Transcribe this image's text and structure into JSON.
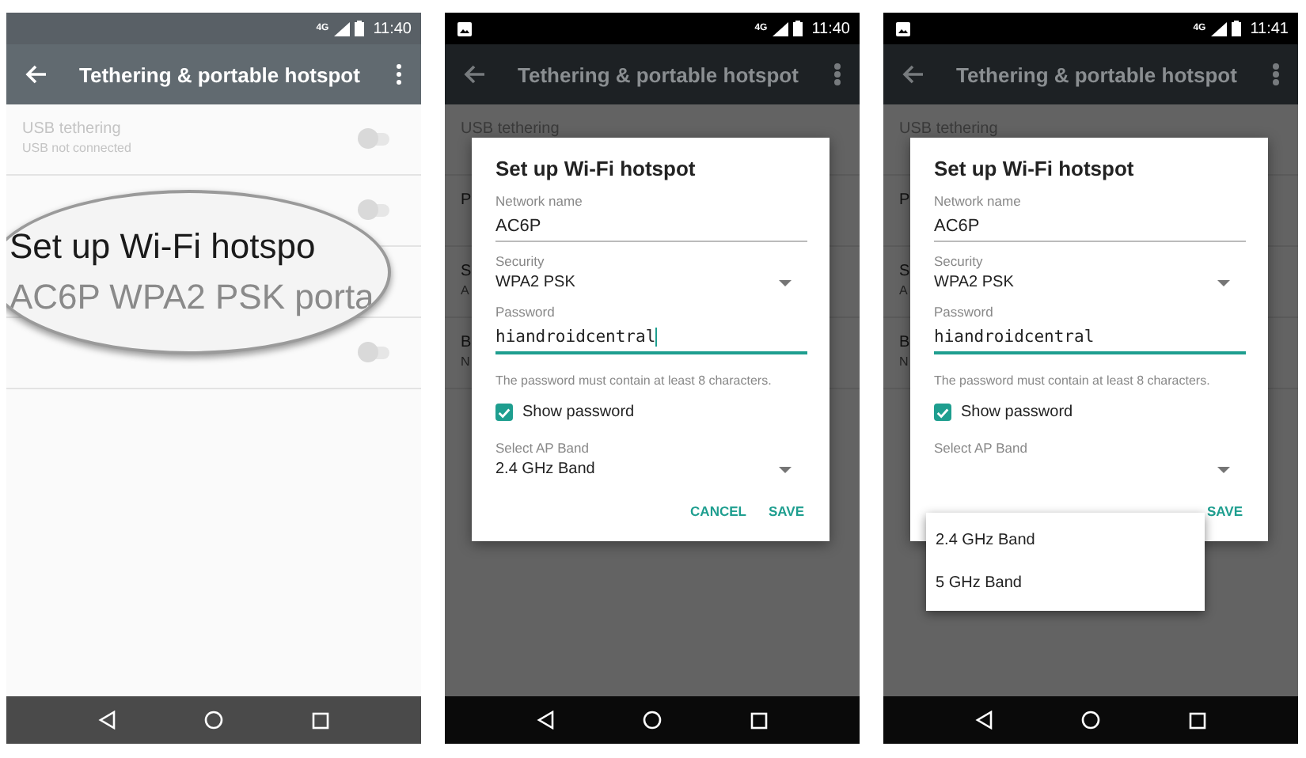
{
  "screens": [
    {
      "status": {
        "time": "11:40",
        "network": "4G",
        "notification_icon": false
      },
      "toolbar": {
        "title": "Tethering & portable hotspot"
      },
      "dimmed": false,
      "rows": [
        {
          "title": "USB tethering",
          "subtitle": "USB not connected",
          "disabled": true,
          "toggle": {
            "on": false
          }
        },
        {
          "toggle": {
            "on": false
          }
        },
        {},
        {
          "toggle": {
            "on": false
          }
        }
      ],
      "magnifier": {
        "lines": [
          "Set up Wi-Fi hotspo",
          "AC6P WPA2 PSK porta"
        ]
      }
    },
    {
      "status": {
        "time": "11:40",
        "network": "4G",
        "notification_icon": true
      },
      "toolbar": {
        "title": "Tethering & portable hotspot"
      },
      "dimmed": true,
      "rows": [
        {
          "title": "USB tethering",
          "disabled": true
        },
        {
          "title": "P"
        },
        {
          "title": "S",
          "subtitle": "A"
        },
        {
          "title": "B",
          "subtitle": "N"
        }
      ],
      "dialog": {
        "title": "Set up Wi-Fi hotspot",
        "fields": [
          {
            "kind": "text",
            "label": "Network name",
            "value": "AC6P",
            "focused": false,
            "cursor": false,
            "mono": false
          },
          {
            "kind": "select",
            "label": "Security",
            "value": "WPA2 PSK"
          },
          {
            "kind": "text",
            "label": "Password",
            "value": "hiandroidcentral",
            "focused": true,
            "cursor": true,
            "mono": true
          },
          {
            "kind": "hint",
            "text": "The password must contain at least 8 characters."
          },
          {
            "kind": "checkbox",
            "label": "Show password",
            "checked": true
          },
          {
            "kind": "select",
            "label": "Select AP Band",
            "value": "2.4 GHz Band"
          }
        ],
        "buttons": [
          "CANCEL",
          "SAVE"
        ]
      }
    },
    {
      "status": {
        "time": "11:41",
        "network": "4G",
        "notification_icon": true
      },
      "toolbar": {
        "title": "Tethering & portable hotspot"
      },
      "dimmed": true,
      "rows": [
        {
          "title": "USB tethering",
          "disabled": true
        },
        {
          "title": "P"
        },
        {
          "title": "S",
          "subtitle": "A"
        },
        {
          "title": "B",
          "subtitle": "N"
        }
      ],
      "dialog": {
        "title": "Set up Wi-Fi hotspot",
        "fields": [
          {
            "kind": "text",
            "label": "Network name",
            "value": "AC6P",
            "focused": false,
            "cursor": false,
            "mono": false
          },
          {
            "kind": "select",
            "label": "Security",
            "value": "WPA2 PSK"
          },
          {
            "kind": "text",
            "label": "Password",
            "value": "hiandroidcentral",
            "focused": true,
            "cursor": false,
            "mono": true
          },
          {
            "kind": "hint",
            "text": "The password must contain at least 8 characters."
          },
          {
            "kind": "checkbox",
            "label": "Show password",
            "checked": true
          },
          {
            "kind": "select",
            "label": "Select AP Band"
          }
        ],
        "buttons": [
          "SAVE"
        ],
        "menu": {
          "options": [
            "2.4 GHz Band",
            "5 GHz Band"
          ]
        }
      }
    }
  ]
}
